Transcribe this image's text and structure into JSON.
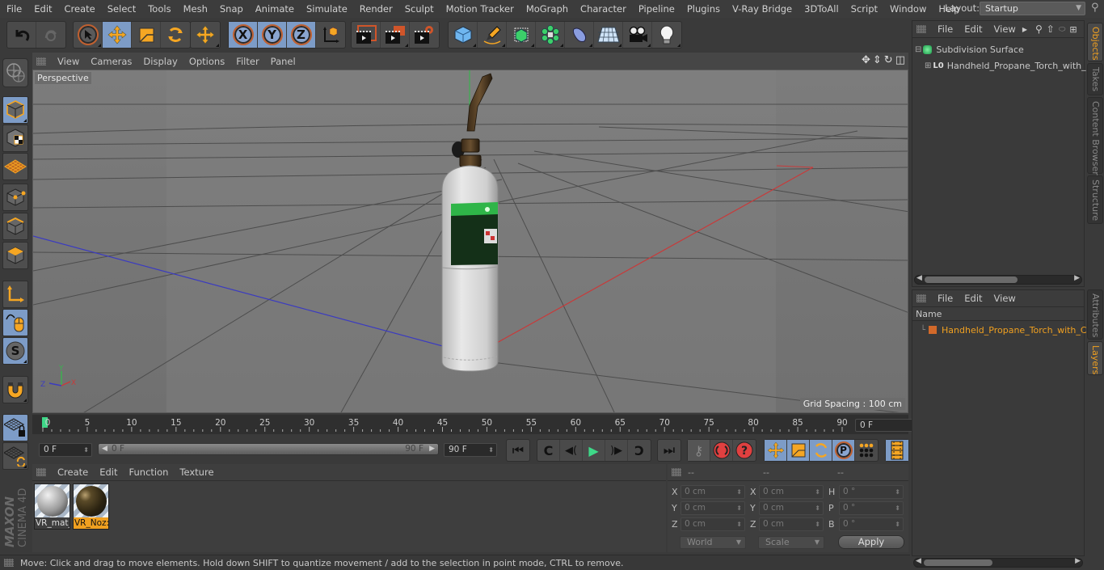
{
  "menubar": {
    "items": [
      "File",
      "Edit",
      "Create",
      "Select",
      "Tools",
      "Mesh",
      "Snap",
      "Animate",
      "Simulate",
      "Render",
      "Sculpt",
      "Motion Tracker",
      "MoGraph",
      "Character",
      "Pipeline",
      "Plugins",
      "V-Ray Bridge",
      "3DToAll",
      "Script",
      "Window",
      "Help"
    ],
    "layout_label": "Layout:",
    "layout_value": "Startup"
  },
  "toolbar": {
    "undo": "undo-icon",
    "redo": "redo-icon",
    "axis_x": "X",
    "axis_y": "Y",
    "axis_z": "Z"
  },
  "viewport": {
    "menu": [
      "View",
      "Cameras",
      "Display",
      "Options",
      "Filter",
      "Panel"
    ],
    "camera_label": "Perspective",
    "grid_spacing": "Grid Spacing : 100 cm",
    "axis_labels": {
      "x": "X",
      "y": "Y",
      "z": "Z"
    }
  },
  "timeline": {
    "ticks": [
      "0",
      "5",
      "10",
      "15",
      "20",
      "25",
      "30",
      "35",
      "40",
      "45",
      "50",
      "55",
      "60",
      "65",
      "70",
      "75",
      "80",
      "85",
      "90"
    ],
    "current_frame": "0 F",
    "start_field": "0 F",
    "range_start": "0 F",
    "range_end": "90 F",
    "end_field": "90 F"
  },
  "materials": {
    "menu": [
      "Create",
      "Edit",
      "Function",
      "Texture"
    ],
    "items": [
      {
        "name": "VR_mat_",
        "selected": false
      },
      {
        "name": "VR_Noz:",
        "selected": true
      }
    ]
  },
  "coords": {
    "headers": [
      "--",
      "--",
      "--"
    ],
    "rows": [
      {
        "l1": "X",
        "v1": "0 cm",
        "l2": "X",
        "v2": "0 cm",
        "l3": "H",
        "v3": "0 °"
      },
      {
        "l1": "Y",
        "v1": "0 cm",
        "l2": "Y",
        "v2": "0 cm",
        "l3": "P",
        "v3": "0 °"
      },
      {
        "l1": "Z",
        "v1": "0 cm",
        "l2": "Z",
        "v2": "0 cm",
        "l3": "B",
        "v3": "0 °"
      }
    ],
    "mode1": "World",
    "mode2": "Scale",
    "apply": "Apply"
  },
  "status": {
    "text": "Move: Click and drag to move elements. Hold down SHIFT to quantize movement / add to the selection in point mode, CTRL to remove."
  },
  "objects_panel": {
    "menu": [
      "File",
      "Edit",
      "View"
    ],
    "items": [
      {
        "name": "Subdivision Surface"
      },
      {
        "name": "Handheld_Propane_Torch_with_"
      }
    ]
  },
  "layers_panel": {
    "menu": [
      "File",
      "Edit",
      "View"
    ],
    "column": "Name",
    "items": [
      {
        "name": "Handheld_Propane_Torch_with_C",
        "color": "#d2692a"
      }
    ]
  },
  "side_tabs": {
    "top": [
      "Objects",
      "Takes",
      "Content Browser",
      "Structure"
    ],
    "bottom": [
      "Attributes",
      "Layers"
    ]
  },
  "colors": {
    "accent_active": "#7d9cc7",
    "highlight_orange": "#f0a020",
    "layer_color": "#d2692a"
  },
  "logo": {
    "brand": "MAXON",
    "product": "CINEMA 4D"
  }
}
